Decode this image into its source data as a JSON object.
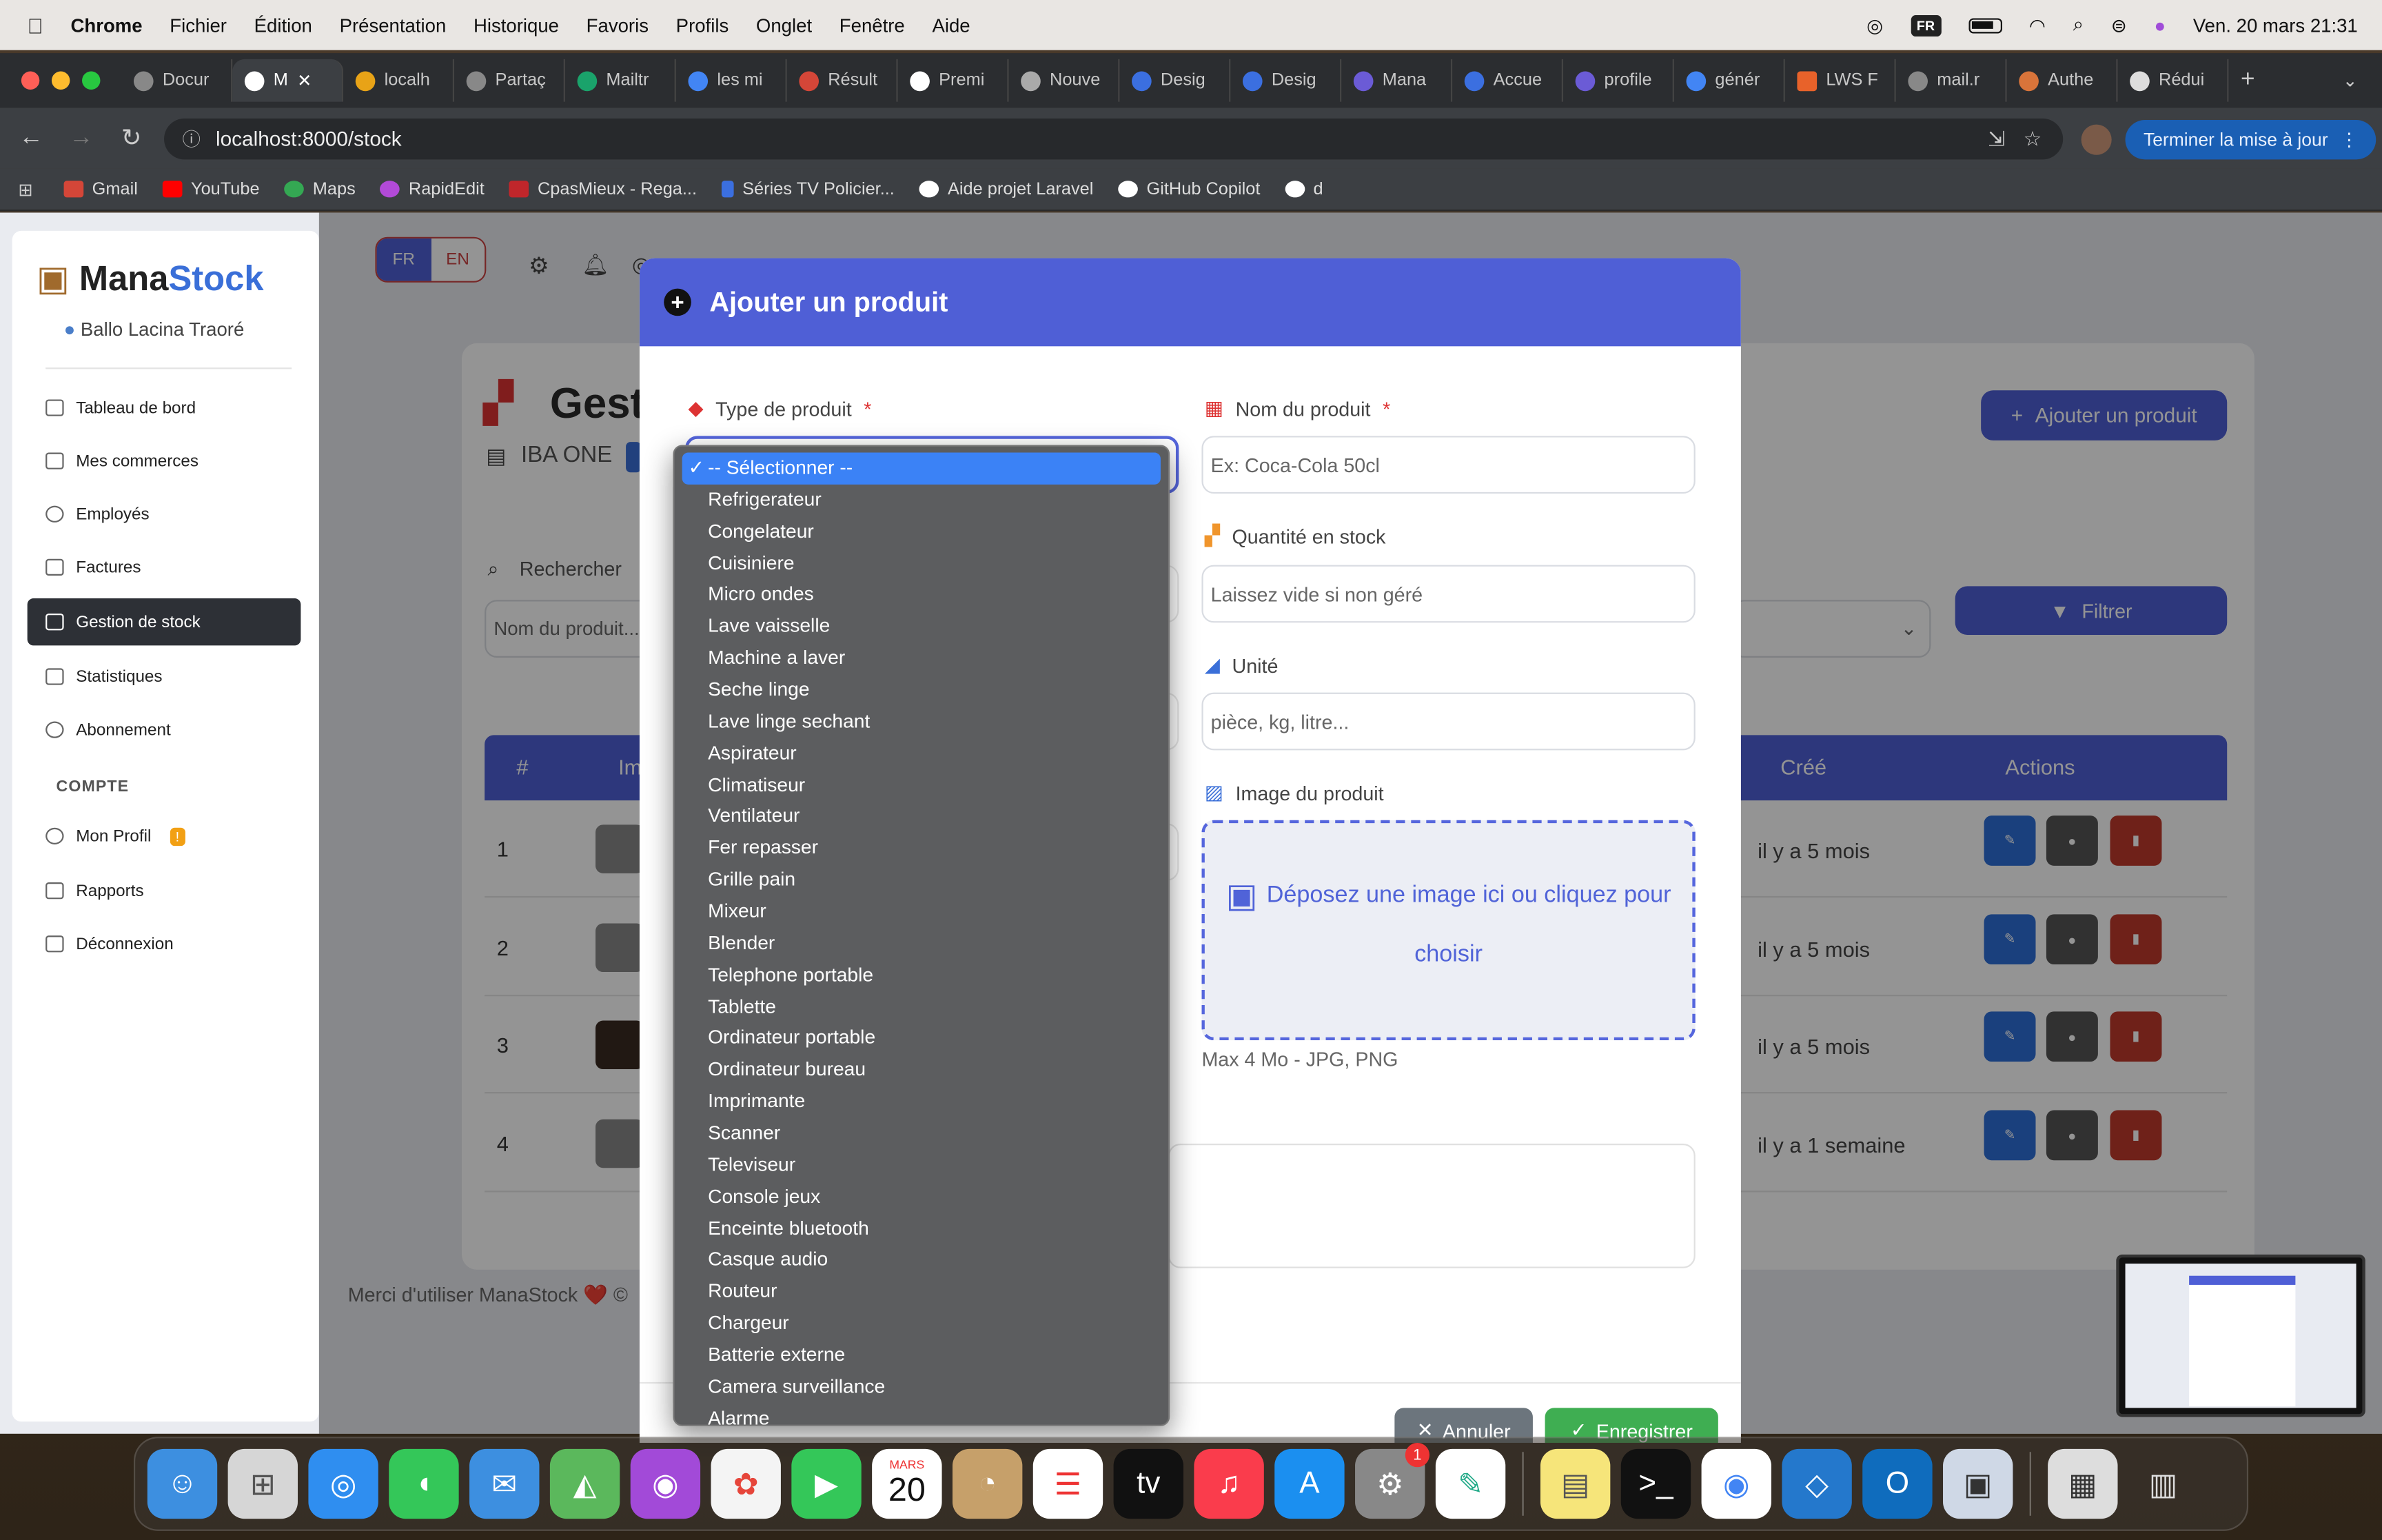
{
  "menubar": {
    "app": "Chrome",
    "items": [
      "Fichier",
      "Édition",
      "Présentation",
      "Historique",
      "Favoris",
      "Profils",
      "Onglet",
      "Fenêtre",
      "Aide"
    ],
    "keyboard": "FR",
    "datetime": "Ven. 20 mars  21:31"
  },
  "tabs": [
    "Docur",
    "M",
    "localh",
    "Partaç",
    "Mailtr",
    "les mi",
    "Résult",
    "Premi",
    "Nouve",
    "Desig",
    "Desig",
    "Mana",
    "Accue",
    "profile",
    "génér",
    "LWS F",
    "mail.r",
    "Authe",
    "Rédui"
  ],
  "toolbar": {
    "url": "localhost:8000/stock",
    "update_label": "Terminer la mise à jour"
  },
  "bookmarks": [
    "Gmail",
    "YouTube",
    "Maps",
    "RapidEdit",
    "CpasMieux - Rega...",
    "Séries TV Policier...",
    "Aide projet Laravel",
    "GitHub Copilot",
    "d"
  ],
  "sidebar": {
    "brand_part1": "Mana",
    "brand_part2": "Stock",
    "user": "Ballo Lacina Traoré",
    "items": [
      {
        "label": "Tableau de bord"
      },
      {
        "label": "Mes commerces"
      },
      {
        "label": "Employés"
      },
      {
        "label": "Factures"
      },
      {
        "label": "Gestion de stock"
      },
      {
        "label": "Statistiques"
      },
      {
        "label": "Abonnement"
      }
    ],
    "category": "COMPTE",
    "account_items": [
      {
        "label": "Mon Profil",
        "badge": "!"
      },
      {
        "label": "Rapports"
      },
      {
        "label": "Déconnexion"
      }
    ]
  },
  "page": {
    "lang_fr": "FR",
    "lang_en": "EN",
    "title_partial": "Gest",
    "shop": "IBA ONE",
    "add_button": "Ajouter un produit",
    "search_label": "Rechercher",
    "search_placeholder": "Nom du produit...",
    "filter_button": "Filtrer",
    "table_headers": {
      "num": "#",
      "img": "Im",
      "created": "Créé",
      "actions": "Actions"
    },
    "rows": [
      {
        "num": "1",
        "created": "il y a 5 mois"
      },
      {
        "num": "2",
        "created": "il y a 5 mois"
      },
      {
        "num": "3",
        "created": "il y a 5 mois"
      },
      {
        "num": "4",
        "created": "il y a 1 semaine"
      }
    ],
    "footer": "Merci d'utiliser ManaStock ❤️ ©"
  },
  "modal": {
    "title": "Ajouter un produit",
    "type_label": "Type de produit",
    "name_label": "Nom du produit",
    "name_placeholder": "Ex: Coca-Cola 50cl",
    "qty_label": "Quantité en stock",
    "qty_placeholder": "Laissez vide si non géré",
    "unit_label": "Unité",
    "unit_placeholder": "pièce, kg, litre...",
    "image_label": "Image du produit",
    "dropzone_text": "Déposez une image ici ou cliquez pour choisir",
    "image_hint": "Max 4 Mo - JPG, PNG",
    "cancel_label": "Annuler",
    "save_label": "Enregistrer",
    "required_mark": "*"
  },
  "dropdown": {
    "selected": "-- Sélectionner --",
    "options": [
      "Refrigerateur",
      "Congelateur",
      "Cuisiniere",
      "Micro ondes",
      "Lave vaisselle",
      "Machine a laver",
      "Seche linge",
      "Lave linge sechant",
      "Aspirateur",
      "Climatiseur",
      "Ventilateur",
      "Fer repasser",
      "Grille pain",
      "Mixeur",
      "Blender",
      "Telephone portable",
      "Tablette",
      "Ordinateur portable",
      "Ordinateur bureau",
      "Imprimante",
      "Scanner",
      "Televiseur",
      "Console jeux",
      "Enceinte bluetooth",
      "Casque audio",
      "Routeur",
      "Chargeur",
      "Batterie externe",
      "Camera surveillance",
      "Alarme"
    ]
  },
  "dock": {
    "calendar_month": "MARS",
    "calendar_day": "20",
    "settings_badge": "1"
  },
  "colors": {
    "accent": "#4f5fd6",
    "brand_blue": "#3a6fd8",
    "active_sidebar": "#2d3036",
    "danger": "#c0392b",
    "success": "#3fae52"
  }
}
